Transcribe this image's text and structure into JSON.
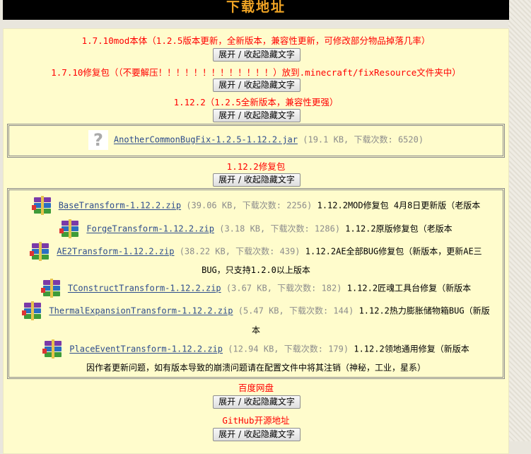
{
  "header": {
    "title": "下载地址"
  },
  "toggle_label": "展开 / 收起隐藏文字",
  "sections": [
    {
      "title": "1.7.10mod本体（1.2.5版本更新，全新版本，兼容性更新，可修改部分物品掉落几率）"
    },
    {
      "title": "1.7.10修复包（（不要解压！！！！！！！！！！！！！）放到.minecraft/fixResource文件夹中）"
    },
    {
      "title": "1.12.2（1.2.5全新版本，兼容性更强）"
    },
    {
      "title": "1.12.2修复包"
    },
    {
      "title": "百度网盘"
    },
    {
      "title": "GitHub开源地址"
    }
  ],
  "files_112": [
    {
      "name": "AnotherCommonBugFix-1.2.5-1.12.2.jar",
      "meta": "(19.1 KB, 下载次数: 6520)",
      "icon": "unknown-file-icon"
    }
  ],
  "files_fix": [
    {
      "name": "BaseTransform-1.12.2.zip",
      "meta": "(39.06 KB, 下载次数: 2256)",
      "desc": "1.12.2MOD修复包 4月8日更新版（老版本",
      "icon": "rar-archive-icon"
    },
    {
      "name": "ForgeTransform-1.12.2.zip",
      "meta": "(3.18 KB, 下载次数: 1286)",
      "desc": "1.12.2原版修复包（老版本",
      "icon": "rar-archive-icon"
    },
    {
      "name": "AE2Transform-1.12.2.zip",
      "meta": "(38.22 KB, 下载次数: 439)",
      "desc": "1.12.2AE全部BUG修复包（新版本，更新AE三",
      "desc2": "BUG，只支持1.2.0以上版本",
      "icon": "rar-archive-icon"
    },
    {
      "name": "TConstructTransform-1.12.2.zip",
      "meta": "(3.67 KB, 下载次数: 182)",
      "desc": "1.12.2匠魂工具台修复（新版本",
      "icon": "rar-archive-icon"
    },
    {
      "name": "ThermalExpansionTransform-1.12.2.zip",
      "meta": "(5.47 KB, 下载次数: 144)",
      "desc": "1.12.2热力膨胀储物箱BUG（新版",
      "desc2": "本",
      "icon": "rar-archive-icon"
    },
    {
      "name": "PlaceEventTransform-1.12.2.zip",
      "meta": "(12.94 KB, 下载次数: 179)",
      "desc": "1.12.2领地通用修复（新版本",
      "icon": "rar-archive-icon"
    }
  ],
  "fix_note": "因作者更新问题，如有版本导致的崩溃问题请在配置文件中将其注销（神秘，工业，星系）"
}
